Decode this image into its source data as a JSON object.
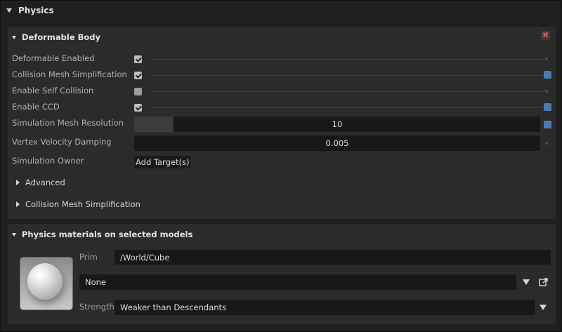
{
  "physics": {
    "title": "Physics"
  },
  "deformable": {
    "title": "Deformable Body",
    "close_glyph": "✖",
    "rows": {
      "deformable_enabled": {
        "label": "Deformable Enabled",
        "checked": true
      },
      "collision_mesh_simplification": {
        "label": "Collision Mesh Simplification",
        "checked": true
      },
      "enable_self_collision": {
        "label": "Enable Self Collision",
        "checked": false
      },
      "enable_ccd": {
        "label": "Enable CCD",
        "checked": true
      },
      "simulation_mesh_resolution": {
        "label": "Simulation Mesh Resolution",
        "value": "10"
      },
      "vertex_velocity_damping": {
        "label": "Vertex Velocity Damping",
        "value": "0.005"
      },
      "simulation_owner": {
        "label": "Simulation Owner",
        "button_label": "Add Target(s)"
      }
    },
    "sections": {
      "advanced": "Advanced",
      "collision_mesh_simplification": "Collision  Mesh  Simplification"
    }
  },
  "materials": {
    "title": "Physics materials on selected models",
    "prim_label": "Prim",
    "prim_value": "/World/Cube",
    "material_value": "None",
    "strength_label": "Strength",
    "strength_value": "Weaker than Descendants"
  },
  "colors": {
    "accent_blue": "#4a7cb2",
    "close_red": "#d9525a",
    "panel_bg": "#2b2b2b",
    "window_bg": "#1f1f1f"
  }
}
